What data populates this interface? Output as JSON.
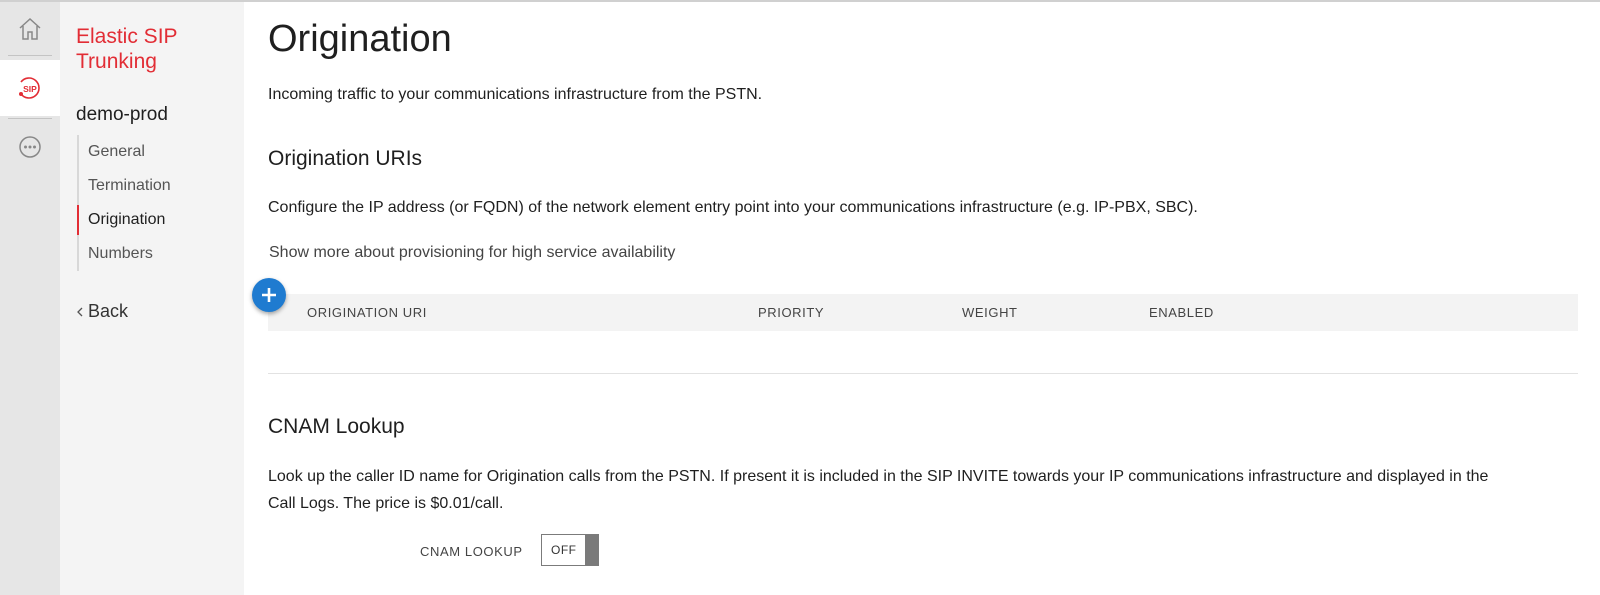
{
  "rail": {
    "items": [
      {
        "icon": "home-icon"
      },
      {
        "icon": "sip-icon",
        "label": "SIP"
      },
      {
        "icon": "more-icon"
      }
    ]
  },
  "nav": {
    "product_title": "Elastic SIP Trunking",
    "trunk_name": "demo-prod",
    "items": [
      {
        "label": "General"
      },
      {
        "label": "Termination"
      },
      {
        "label": "Origination"
      },
      {
        "label": "Numbers"
      }
    ],
    "back_label": "Back"
  },
  "main": {
    "title": "Origination",
    "intro": "Incoming traffic to your communications infrastructure from the PSTN.",
    "uris": {
      "heading": "Origination URIs",
      "description": "Configure the IP address (or FQDN) of the network element entry point into your communications infrastructure (e.g. IP-PBX, SBC).",
      "show_more": "Show more about provisioning for high service availability",
      "columns": [
        "ORIGINATION URI",
        "PRIORITY",
        "WEIGHT",
        "ENABLED"
      ]
    },
    "cnam": {
      "heading": "CNAM Lookup",
      "description_line1": "Look up the caller ID name for Origination calls from the PSTN. If present it is included in the SIP INVITE towards your IP communications infrastructure and displayed in the",
      "description_line2": "Call Logs. The price is $0.01/call.",
      "toggle_label": "CNAM LOOKUP",
      "toggle_state": "OFF"
    }
  },
  "colors": {
    "brand": "#e22d35",
    "add_button": "#1f7bd0"
  }
}
